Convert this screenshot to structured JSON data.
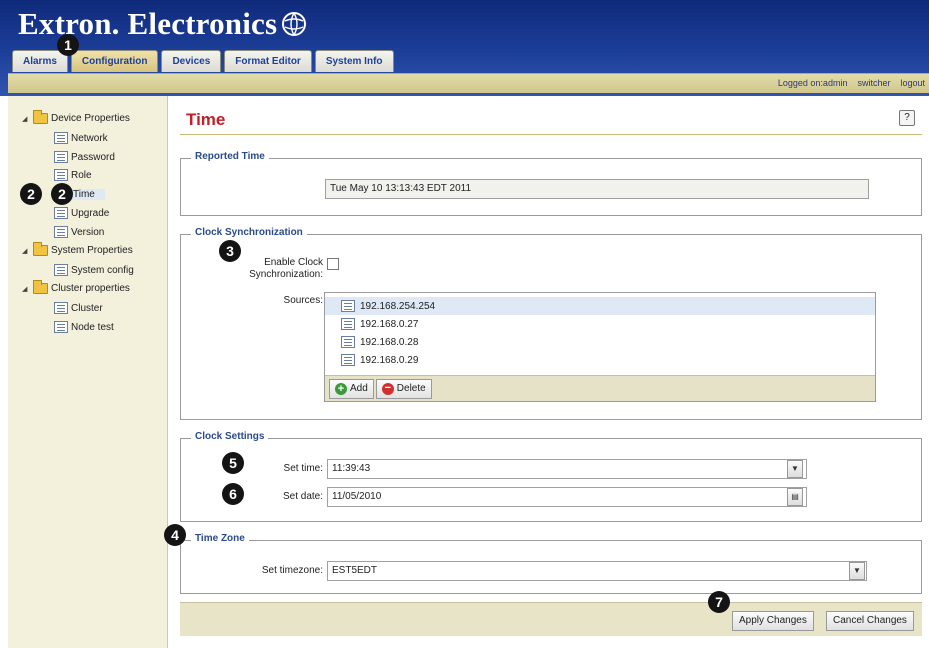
{
  "header": {
    "brand": "Extron. Electronics",
    "tabs": [
      {
        "label": "Alarms"
      },
      {
        "label": "Configuration"
      },
      {
        "label": "Devices"
      },
      {
        "label": "Format Editor"
      },
      {
        "label": "System Info"
      }
    ],
    "active_tab": "Configuration",
    "status_links": [
      "Logged on:admin",
      "switcher",
      "logout"
    ]
  },
  "sidebar": {
    "groups": [
      {
        "label": "Device Properties",
        "items": [
          "Network",
          "Password",
          "Role",
          "Time",
          "Upgrade",
          "Version"
        ]
      },
      {
        "label": "System Properties",
        "items": [
          "System config"
        ]
      },
      {
        "label": "Cluster properties",
        "items": [
          "Cluster",
          "Node test"
        ]
      }
    ],
    "selected_item": "Time"
  },
  "main": {
    "title": "Time",
    "help": "?",
    "reported_time": {
      "legend": "Reported Time",
      "value": "Tue May 10 13:13:43 EDT 2011"
    },
    "clock_sync": {
      "legend": "Clock Synchronization",
      "enable_label_line1": "Enable Clock",
      "enable_label_line2": "Synchronization:",
      "enabled": false,
      "sources_label": "Sources:",
      "sources": [
        "192.168.254.254",
        "192.168.0.27",
        "192.168.0.28",
        "192.168.0.29"
      ],
      "add_label": "Add",
      "delete_label": "Delete"
    },
    "clock_settings": {
      "legend": "Clock Settings",
      "time_label": "Set time:",
      "time_value": "11:39:43",
      "date_label": "Set date:",
      "date_value": "11/05/2010"
    },
    "time_zone": {
      "legend": "Time Zone",
      "label": "Set timezone:",
      "value": "EST5EDT"
    },
    "apply_label": "Apply Changes",
    "cancel_label": "Cancel Changes"
  },
  "callouts": [
    "1",
    "2",
    "2",
    "3",
    "4",
    "5",
    "6",
    "7"
  ],
  "colors": {
    "header_blue": "#1d3f9a",
    "title_red": "#c0202a",
    "legend_blue": "#2a4a8a",
    "sidebar_bg": "#f3f0dc",
    "selection": "#dfe8f5"
  }
}
